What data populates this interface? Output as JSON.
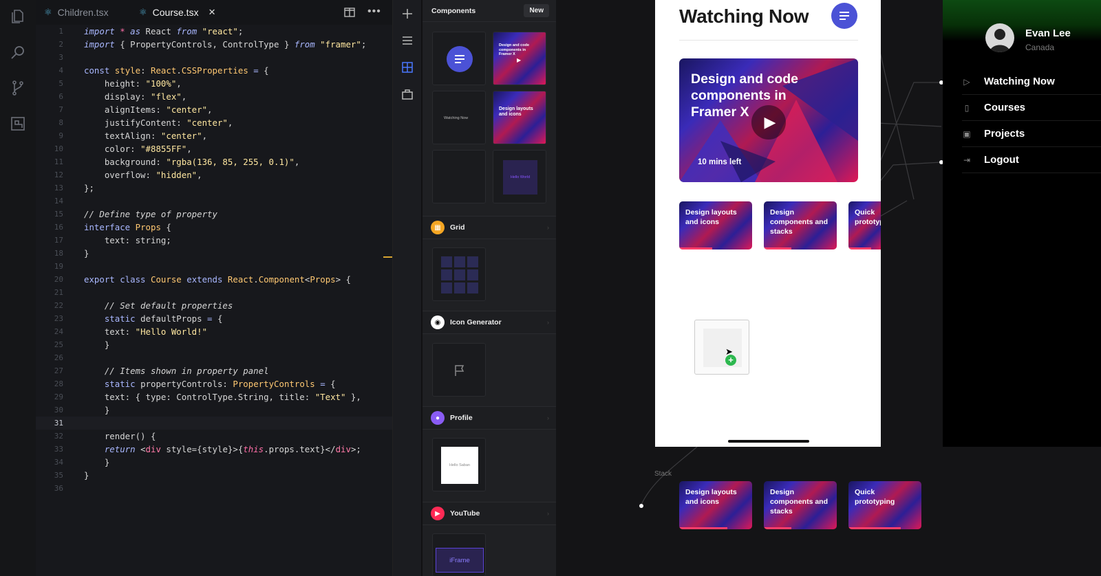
{
  "editor": {
    "tabs": [
      {
        "label": "Children.tsx",
        "active": false
      },
      {
        "label": "Course.tsx",
        "active": true
      }
    ],
    "current_line": 31,
    "line_numbers": [
      "1",
      "2",
      "3",
      "4",
      "5",
      "6",
      "7",
      "8",
      "9",
      "10",
      "11",
      "12",
      "13",
      "14",
      "15",
      "16",
      "17",
      "18",
      "19",
      "20",
      "21",
      "22",
      "23",
      "24",
      "25",
      "26",
      "27",
      "28",
      "29",
      "30",
      "31",
      "32",
      "33",
      "34",
      "35",
      "36"
    ]
  },
  "panel": {
    "title": "Components",
    "new_label": "New",
    "thumbs": {
      "hero_mini": "Design and code components in Framer X",
      "watching_mini": "Watching Now",
      "layouts_mini": "Design layouts and icons",
      "hello_mini": "Hello World",
      "profile_mini": "Hello Saban",
      "iframe": "iFrame"
    },
    "sections": [
      {
        "name": "Grid",
        "color": "#f5a623"
      },
      {
        "name": "Icon Generator",
        "color": "#ffffff"
      },
      {
        "name": "Profile",
        "color": "#8a5cf5"
      },
      {
        "name": "YouTube",
        "color": "#ff2a55"
      }
    ]
  },
  "device": {
    "title": "Watching Now",
    "hero": {
      "title": "Design and code components in Framer X",
      "time_left": "10 mins left"
    },
    "cards": [
      {
        "title": "Design layouts and icons",
        "progress": 0.45
      },
      {
        "title": "Design components and stacks",
        "progress": 0.38
      },
      {
        "title": "Quick prototyping",
        "progress": 0.7
      }
    ]
  },
  "stack": {
    "label": "Stack",
    "cards": [
      {
        "title": "Design layouts and icons",
        "progress": 0.66
      },
      {
        "title": "Design components and stacks",
        "progress": 0.38
      },
      {
        "title": "Quick prototyping",
        "progress": 0.72
      }
    ]
  },
  "sidemenu": {
    "user": {
      "name": "Evan Lee",
      "location": "Canada"
    },
    "items": [
      {
        "label": "Watching Now",
        "icon": "play-icon"
      },
      {
        "label": "Courses",
        "icon": "book-icon"
      },
      {
        "label": "Projects",
        "icon": "image-icon"
      },
      {
        "label": "Logout",
        "icon": "logout-icon"
      }
    ]
  },
  "colors": {
    "accent": "#4b52d6",
    "code_bg": "#17181c",
    "canvas_bg": "#141416"
  }
}
